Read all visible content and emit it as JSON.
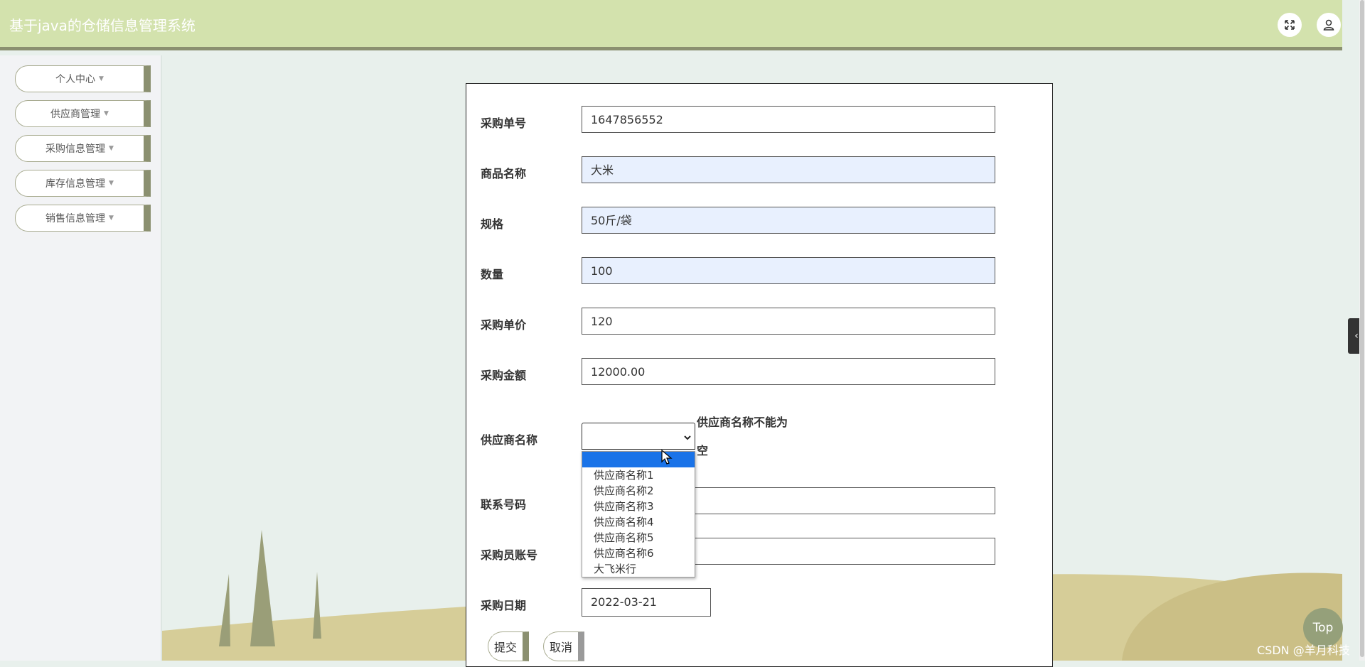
{
  "app": {
    "title": "基于java的仓储信息管理系统"
  },
  "header": {
    "icons": [
      "fullscreen-icon",
      "user-icon"
    ]
  },
  "sidebar": {
    "items": [
      {
        "label": "个人中心"
      },
      {
        "label": "供应商管理"
      },
      {
        "label": "采购信息管理"
      },
      {
        "label": "库存信息管理"
      },
      {
        "label": "销售信息管理"
      }
    ]
  },
  "form": {
    "order_no": {
      "label": "采购单号",
      "value": "1647856552"
    },
    "product_name": {
      "label": "商品名称",
      "value": "大米"
    },
    "spec": {
      "label": "规格",
      "value": "50斤/袋"
    },
    "quantity": {
      "label": "数量",
      "value": "100"
    },
    "unit_price": {
      "label": "采购单价",
      "value": "120"
    },
    "amount": {
      "label": "采购金额",
      "value": "12000.00"
    },
    "supplier": {
      "label": "供应商名称",
      "value": "",
      "error_line1": "供应商名称不能为",
      "error_line2": "空",
      "options": [
        "",
        "供应商名称1",
        "供应商名称2",
        "供应商名称3",
        "供应商名称4",
        "供应商名称5",
        "供应商名称6",
        "大飞米行"
      ]
    },
    "phone": {
      "label": "联系号码",
      "value": ""
    },
    "buyer_account": {
      "label": "采购员账号",
      "value": ""
    },
    "date": {
      "label": "采购日期",
      "value": "2022-03-21"
    },
    "submit_label": "提交",
    "cancel_label": "取消"
  },
  "top_button": "Top",
  "side_tab": "‹",
  "watermark": "CSDN @羊月科技",
  "colors": {
    "header_bg": "#d3e2ad",
    "accent": "#8b9070",
    "highlight": "#1a73e8",
    "autofill": "#e8f0fe"
  }
}
